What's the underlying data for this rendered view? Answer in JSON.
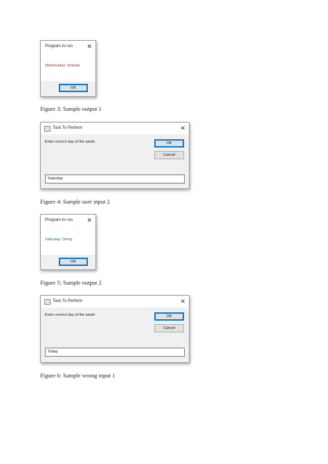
{
  "figures": [
    {
      "kind": "message-box",
      "title": "Program to run",
      "message": "Wednesday: Sinhala",
      "message_color": "#9b2c2c",
      "ok_label": "OK",
      "caption": "Figure 3: Sample output 1"
    },
    {
      "kind": "input-box",
      "title": "Task To Perform",
      "prompt": "Enter correct day of the week:",
      "ok_label": "OK",
      "cancel_label": "Cancel",
      "input_value": "Saturday",
      "caption": "Figure 4: Sample user input 2"
    },
    {
      "kind": "message-box",
      "title": "Program to run",
      "message": "Saturday: Doing",
      "message_color": "#2a6f2a",
      "ok_label": "OK",
      "caption": "Figure 5: Sample output 2"
    },
    {
      "kind": "input-box",
      "title": "Task To Perform",
      "prompt": "Enter correct day of the week:",
      "ok_label": "OK",
      "cancel_label": "Cancel",
      "input_value": "Today",
      "caption": "Figure 6: Sample wrong input 1"
    }
  ],
  "icons": {
    "close": "close-icon",
    "app": "app-window-icon"
  }
}
